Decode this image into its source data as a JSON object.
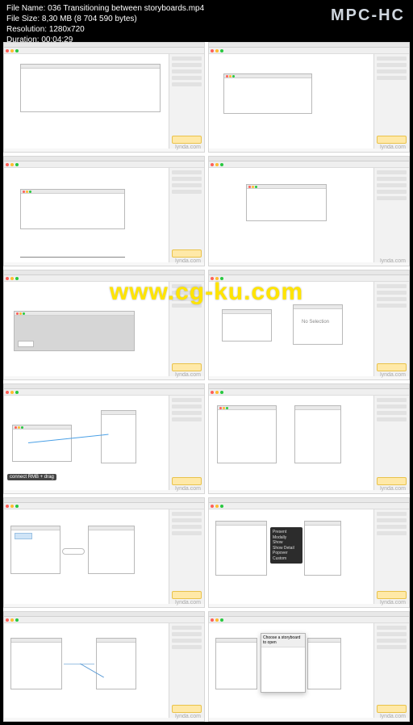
{
  "player": {
    "brand": "MPC-HC",
    "meta": {
      "file_label": "File Name:",
      "file_name": "036 Transitioning between storyboards.mp4",
      "size_label": "File Size:",
      "size": "8,30 MB (8 704 590 bytes)",
      "res_label": "Resolution:",
      "res": "1280x720",
      "dur_label": "Duration:",
      "dur": "00:04:29"
    }
  },
  "watermark_big": "www.cg-ku.com",
  "thumb_watermark": "lynda.com",
  "tooltip_connect": "connect  RMB + drag",
  "darkpanel_lines": [
    "Present Modally",
    "Show",
    "Show Detail",
    "Popover",
    "Custom"
  ],
  "popup_title": "Choose a storyboard to open"
}
